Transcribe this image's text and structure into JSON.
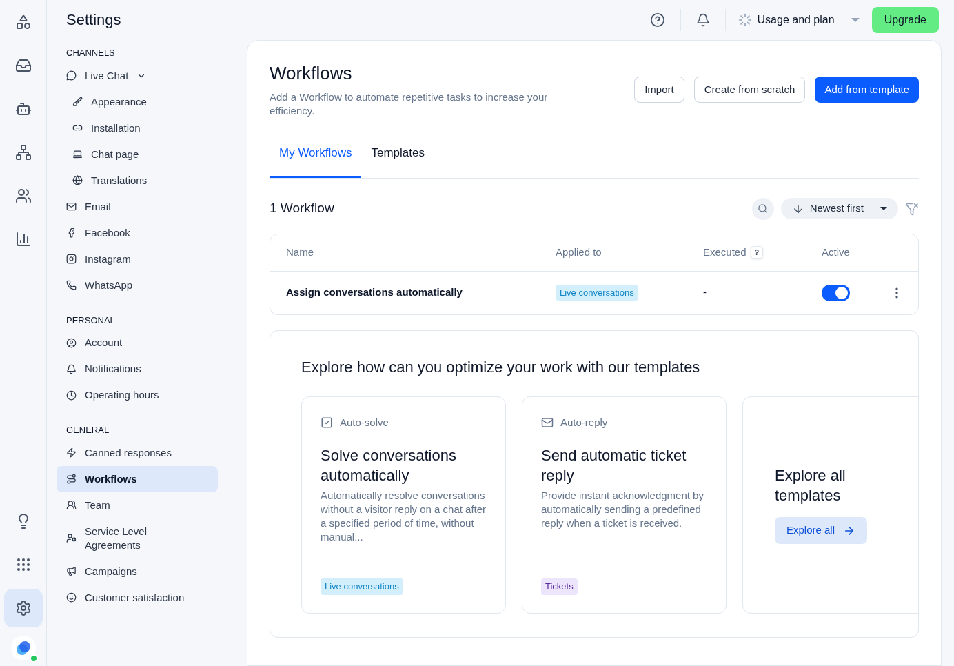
{
  "rail": {
    "top": [
      {
        "kind": "shapes",
        "selected": false
      },
      {
        "kind": "inbox",
        "selected": false
      },
      {
        "kind": "bot",
        "selected": false
      },
      {
        "kind": "network",
        "selected": false
      },
      {
        "kind": "users",
        "selected": false
      },
      {
        "kind": "chart",
        "selected": false
      }
    ],
    "bottom": [
      {
        "kind": "bulb",
        "selected": false
      },
      {
        "kind": "grid",
        "selected": false
      },
      {
        "kind": "settings",
        "selected": true
      }
    ],
    "status_online": true
  },
  "sidebar": {
    "title": "Settings",
    "sections": [
      {
        "title": "CHANNELS",
        "items": [
          {
            "label": "Live Chat",
            "kind": "chat",
            "selected": false,
            "expanded": true,
            "children": [
              {
                "label": "Appearance",
                "kind": "brush",
                "selected": false
              },
              {
                "label": "Installation",
                "kind": "link",
                "selected": false
              },
              {
                "label": "Chat page",
                "kind": "laptop",
                "selected": false
              },
              {
                "label": "Translations",
                "kind": "globe",
                "selected": false
              }
            ]
          },
          {
            "label": "Email",
            "kind": "mail",
            "selected": false
          },
          {
            "label": "Facebook",
            "kind": "facebook",
            "selected": false
          },
          {
            "label": "Instagram",
            "kind": "instagram",
            "selected": false
          },
          {
            "label": "WhatsApp",
            "kind": "whatsapp",
            "selected": false
          }
        ]
      },
      {
        "title": "PERSONAL",
        "items": [
          {
            "label": "Account",
            "kind": "account",
            "selected": false
          },
          {
            "label": "Notifications",
            "kind": "bell",
            "selected": false
          },
          {
            "label": "Operating hours",
            "kind": "clock",
            "selected": false
          }
        ]
      },
      {
        "title": "GENERAL",
        "items": [
          {
            "label": "Canned responses",
            "kind": "zap",
            "selected": false
          },
          {
            "label": "Workflows",
            "kind": "route",
            "selected": true
          },
          {
            "label": "Team",
            "kind": "team",
            "selected": false
          },
          {
            "label": "Service Level Agreements",
            "kind": "sla",
            "selected": false
          },
          {
            "label": "Campaigns",
            "kind": "campaign",
            "selected": false
          },
          {
            "label": "Customer satisfaction",
            "kind": "smile",
            "selected": false
          }
        ]
      }
    ]
  },
  "topbar": {
    "usage": "Usage and plan",
    "upgrade": "Upgrade"
  },
  "page": {
    "title": "Workflows",
    "description": "Add a Workflow to automate repetitive tasks to increase your efficiency.",
    "buttons": [
      {
        "label": "Import",
        "kind": "outline"
      },
      {
        "label": "Create from scratch",
        "kind": "outline"
      },
      {
        "label": "Add from template",
        "kind": "primary"
      }
    ],
    "tabs": [
      {
        "label": "My Workflows",
        "selected": true
      },
      {
        "label": "Templates",
        "selected": false
      }
    ],
    "count": "1 Workflow",
    "sort": "Newest first",
    "table": {
      "columns": [
        "Name",
        "Applied to",
        "Executed",
        "Active"
      ],
      "help": "?",
      "rows": [
        {
          "name": "Assign conversations automatically",
          "applied_to": {
            "label": "Live conversations",
            "color": "#0f84c7"
          },
          "executed": "-",
          "active": true
        }
      ]
    },
    "explore": {
      "title": "Explore how can you optimize your work with our templates",
      "cards": [
        {
          "category": "Auto-solve",
          "kind": "check",
          "title": "Solve conversations automatically",
          "description": "Automatically resolve conversations without a visitor reply on a chat after a specified period of time, without manual...",
          "tag": {
            "label": "Live conversations",
            "color": "#0f84c7"
          }
        },
        {
          "category": "Auto-reply",
          "kind": "mail",
          "title": "Send automatic ticket reply",
          "description": "Provide instant acknowledgment by automatically sending a predefined reply when a ticket is received.",
          "tag": {
            "label": "Tickets",
            "color": "#5b2c9e"
          }
        }
      ],
      "all": {
        "title": "Explore all templates",
        "button": "Explore all"
      }
    }
  }
}
